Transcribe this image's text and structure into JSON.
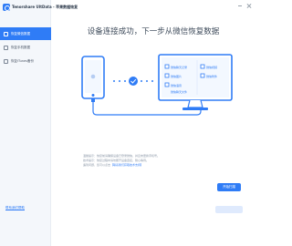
{
  "app": {
    "name": "Tenorshare UltData - 苹果数据恢复",
    "window_controls": [
      "minimize",
      "close"
    ]
  },
  "sidebar": {
    "items": [
      {
        "label": "恢复微信数据",
        "icon": "wechat-icon",
        "active": true
      },
      {
        "label": "恢复手机数据",
        "icon": "phone-icon",
        "active": false
      },
      {
        "label": "恢复iTunes备份",
        "icon": "itunes-icon",
        "active": false
      }
    ],
    "bottom_link": "联系我们帮助"
  },
  "main": {
    "title": "设备连接成功，下一步从微信恢复数据",
    "monitor_items": [
      "微信聊天记录",
      "微信图片",
      "微信语音",
      "微信视频",
      "微信附件",
      "微信聊天文件"
    ],
    "notes": [
      "温馨提示：恢复前请确保设备已登录微信，并且未更换手机号。",
      "技术提示：恢复过程中请勿断开设备连接，耐心等待。",
      "遇到问题，您可以点击"
    ],
    "notes_link": "【联系我们获取技术支持】",
    "next_button": "开始扫描"
  },
  "colors": {
    "accent": "#2f7cf6",
    "sidebar_bg": "#f4f7fb",
    "title_text": "#3d4a5a",
    "note_text": "#8a96a6"
  }
}
